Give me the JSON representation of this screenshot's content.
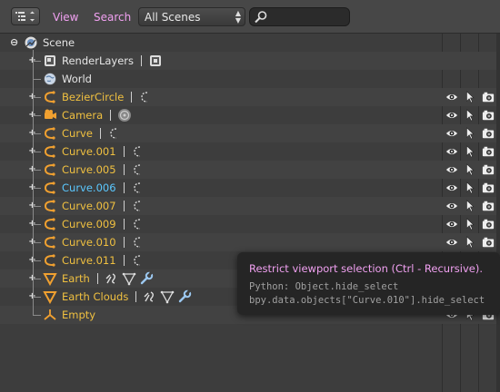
{
  "header": {
    "menus": [
      {
        "label": "View"
      },
      {
        "label": "Search"
      }
    ],
    "display_mode": "All Scenes",
    "search": {
      "value": "",
      "icon": "magnifier-icon"
    }
  },
  "tree": [
    {
      "label": "Scene",
      "icon": "scene-icon",
      "level": 0,
      "expanded": true,
      "style": "plain"
    },
    {
      "label": "RenderLayers",
      "icon": "render-layers-icon",
      "level": 1,
      "expander": "plus",
      "style": "plain",
      "extras": [
        "render-layer-icon"
      ]
    },
    {
      "label": "World",
      "icon": "world-icon",
      "level": 1,
      "expander": "none",
      "style": "plain"
    },
    {
      "label": "BezierCircle",
      "icon": "curve-object-icon",
      "level": 1,
      "expander": "plus",
      "style": "obj",
      "extras": [
        "curve-data-icon"
      ],
      "restrict": true
    },
    {
      "label": "Camera",
      "icon": "camera-object-icon",
      "level": 1,
      "expander": "plus",
      "style": "obj",
      "extras": [
        "camera-data-icon"
      ],
      "restrict": true
    },
    {
      "label": "Curve",
      "icon": "curve-object-icon",
      "level": 1,
      "expander": "plus",
      "style": "obj",
      "extras": [
        "curve-data-icon"
      ],
      "restrict": true
    },
    {
      "label": "Curve.001",
      "icon": "curve-object-icon",
      "level": 1,
      "expander": "plus",
      "style": "obj",
      "extras": [
        "curve-data-icon"
      ],
      "restrict": true
    },
    {
      "label": "Curve.005",
      "icon": "curve-object-icon",
      "level": 1,
      "expander": "plus",
      "style": "obj",
      "extras": [
        "curve-data-icon"
      ],
      "restrict": true
    },
    {
      "label": "Curve.006",
      "icon": "curve-object-icon",
      "level": 1,
      "expander": "plus",
      "style": "sel",
      "extras": [
        "curve-data-icon"
      ],
      "restrict": true
    },
    {
      "label": "Curve.007",
      "icon": "curve-object-icon",
      "level": 1,
      "expander": "plus",
      "style": "obj",
      "extras": [
        "curve-data-icon"
      ],
      "restrict": true
    },
    {
      "label": "Curve.009",
      "icon": "curve-object-icon",
      "level": 1,
      "expander": "plus",
      "style": "obj",
      "extras": [
        "curve-data-icon"
      ],
      "restrict": true
    },
    {
      "label": "Curve.010",
      "icon": "curve-object-icon",
      "level": 1,
      "expander": "plus",
      "style": "obj",
      "extras": [
        "curve-data-icon"
      ],
      "restrict": true
    },
    {
      "label": "Curve.011",
      "icon": "curve-object-icon",
      "level": 1,
      "expander": "plus",
      "style": "obj",
      "extras": [
        "curve-data-icon"
      ],
      "restrict": true
    },
    {
      "label": "Earth",
      "icon": "mesh-object-icon",
      "level": 1,
      "expander": "plus",
      "style": "obj",
      "extras": [
        "modifier-icon",
        "mesh-data-icon",
        "wrench-icon"
      ],
      "restrict": true
    },
    {
      "label": "Earth Clouds",
      "icon": "mesh-object-icon",
      "level": 1,
      "expander": "plus",
      "style": "obj",
      "extras": [
        "modifier-icon",
        "mesh-data-icon",
        "wrench-icon"
      ],
      "restrict": true
    },
    {
      "label": "Empty",
      "icon": "empty-object-icon",
      "level": 1,
      "expander": "none",
      "style": "obj",
      "restrict": true
    }
  ],
  "restrict_columns": [
    "eye-icon",
    "cursor-arrow-icon",
    "render-camera-icon"
  ],
  "tooltip": {
    "title": "Restrict viewport selection (Ctrl - Recursive).",
    "python": "Python: Object.hide_select",
    "path": "bpy.data.objects[\"Curve.010\"].hide_select"
  },
  "colors": {
    "menu_text": "#f0a0f0",
    "object_text": "#f0c040",
    "selected_text": "#5bc8ff",
    "background": "#3d3d3d"
  }
}
